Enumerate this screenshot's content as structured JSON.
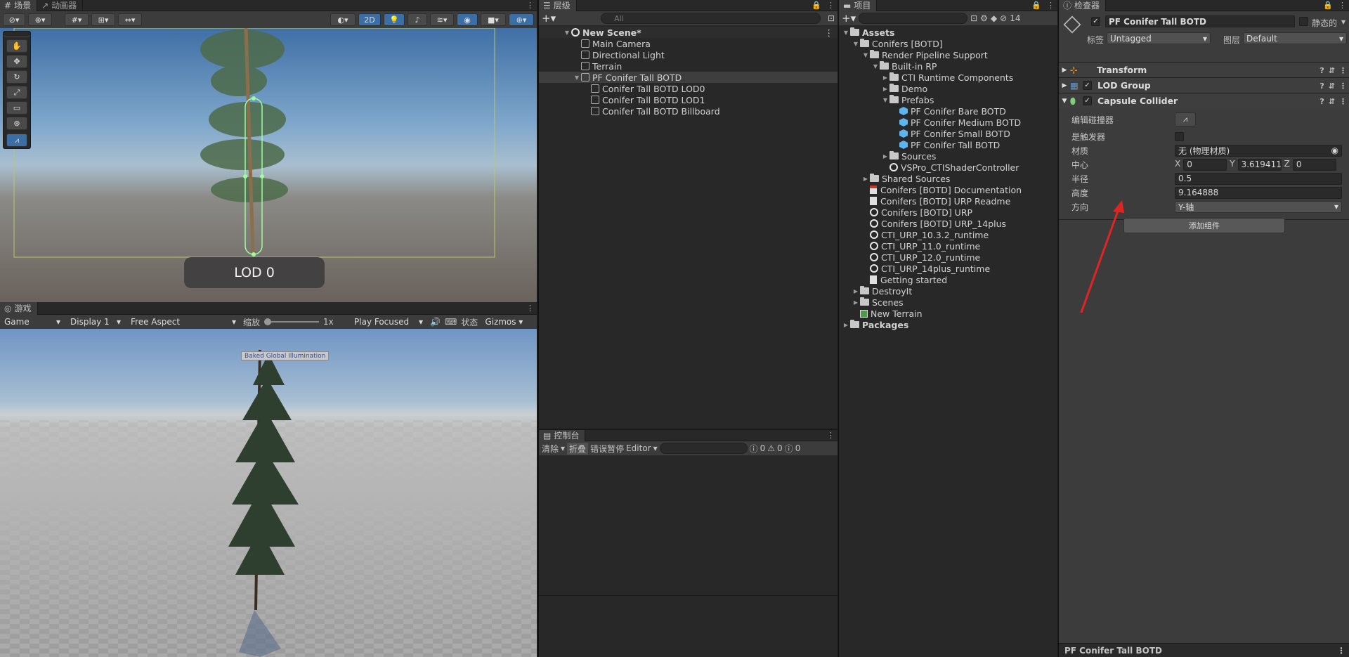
{
  "scene": {
    "tabs": [
      "场景",
      "动画器"
    ],
    "toolbar": {
      "mode_2d": "2D"
    },
    "lod_label": "LOD 0"
  },
  "game": {
    "tab": "游戏",
    "display_mode": "Game",
    "display": "Display 1",
    "aspect": "Free Aspect",
    "scale_label": "缩放",
    "scale_value": "1x",
    "play_mode": "Play Focused",
    "stats": "状态",
    "gizmos": "Gizmos",
    "tooltip": "Baked Global Illumination"
  },
  "hierarchy": {
    "tab": "层级",
    "search_placeholder": "All",
    "scene_name": "New Scene*",
    "items": [
      {
        "label": "Main Camera",
        "depth": 1
      },
      {
        "label": "Directional Light",
        "depth": 1
      },
      {
        "label": "Terrain",
        "depth": 1
      },
      {
        "label": "PF Conifer Tall BOTD",
        "depth": 1,
        "expanded": true,
        "selected": true
      },
      {
        "label": "Conifer Tall BOTD LOD0",
        "depth": 2
      },
      {
        "label": "Conifer Tall BOTD LOD1",
        "depth": 2
      },
      {
        "label": "Conifer Tall BOTD Billboard",
        "depth": 2
      }
    ]
  },
  "console": {
    "tab": "控制台",
    "clear": "清除",
    "collapse": "折叠",
    "error_pause": "错误暂停",
    "editor": "Editor",
    "log_count": "0",
    "warn_count": "0",
    "error_count": "0"
  },
  "project": {
    "tab": "项目",
    "hidden_count": "14",
    "tree": [
      {
        "label": "Assets",
        "depth": 0,
        "type": "folder",
        "bold": true,
        "expanded": true
      },
      {
        "label": "Conifers [BOTD]",
        "depth": 1,
        "type": "folder",
        "expanded": true
      },
      {
        "label": "Render Pipeline Support",
        "depth": 2,
        "type": "folder",
        "expanded": true
      },
      {
        "label": "Built-in RP",
        "depth": 3,
        "type": "folder",
        "expanded": true
      },
      {
        "label": "CTI Runtime Components",
        "depth": 4,
        "type": "folder",
        "collapsed": true
      },
      {
        "label": "Demo",
        "depth": 4,
        "type": "folder",
        "collapsed": true
      },
      {
        "label": "Prefabs",
        "depth": 4,
        "type": "folder",
        "expanded": true
      },
      {
        "label": "PF Conifer Bare BOTD",
        "depth": 5,
        "type": "prefab"
      },
      {
        "label": "PF Conifer Medium BOTD",
        "depth": 5,
        "type": "prefab"
      },
      {
        "label": "PF Conifer Small BOTD",
        "depth": 5,
        "type": "prefab"
      },
      {
        "label": "PF Conifer Tall BOTD",
        "depth": 5,
        "type": "prefab"
      },
      {
        "label": "Sources",
        "depth": 4,
        "type": "folder",
        "collapsed": true
      },
      {
        "label": "VSPro_CTIShaderController",
        "depth": 4,
        "type": "unity"
      },
      {
        "label": "Shared Sources",
        "depth": 2,
        "type": "folder",
        "collapsed": true
      },
      {
        "label": "Conifers [BOTD] Documentation",
        "depth": 2,
        "type": "pdf"
      },
      {
        "label": "Conifers [BOTD] URP Readme",
        "depth": 2,
        "type": "doc"
      },
      {
        "label": "Conifers [BOTD] URP",
        "depth": 2,
        "type": "unity"
      },
      {
        "label": "Conifers [BOTD] URP_14plus",
        "depth": 2,
        "type": "unity"
      },
      {
        "label": "CTI_URP_10.3.2_runtime",
        "depth": 2,
        "type": "unity"
      },
      {
        "label": "CTI_URP_11.0_runtime",
        "depth": 2,
        "type": "unity"
      },
      {
        "label": "CTI_URP_12.0_runtime",
        "depth": 2,
        "type": "unity"
      },
      {
        "label": "CTI_URP_14plus_runtime",
        "depth": 2,
        "type": "unity"
      },
      {
        "label": "Getting started",
        "depth": 2,
        "type": "doc"
      },
      {
        "label": "DestroyIt",
        "depth": 1,
        "type": "folder",
        "collapsed": true
      },
      {
        "label": "Scenes",
        "depth": 1,
        "type": "folder",
        "collapsed": true
      },
      {
        "label": "New Terrain",
        "depth": 1,
        "type": "terrain"
      },
      {
        "label": "Packages",
        "depth": 0,
        "type": "folder",
        "bold": true,
        "collapsed": true
      }
    ]
  },
  "inspector": {
    "tab": "检查器",
    "object_name": "PF Conifer Tall BOTD",
    "static_label": "静态的",
    "tag_label": "标签",
    "tag_value": "Untagged",
    "layer_label": "图层",
    "layer_value": "Default",
    "components": [
      "Transform",
      "LOD Group",
      "Capsule Collider"
    ],
    "collider": {
      "edit_collider": "编辑碰撞器",
      "is_trigger": "是触发器",
      "material_label": "材质",
      "material_value": "无 (物理材质)",
      "center_label": "中心",
      "center_x": "0",
      "center_y": "3.619411",
      "center_z": "0",
      "radius_label": "半径",
      "radius_value": "0.5",
      "height_label": "高度",
      "height_value": "9.164888",
      "direction_label": "方向",
      "direction_value": "Y-轴"
    },
    "add_component": "添加组件",
    "footer_name": "PF Conifer Tall BOTD"
  }
}
